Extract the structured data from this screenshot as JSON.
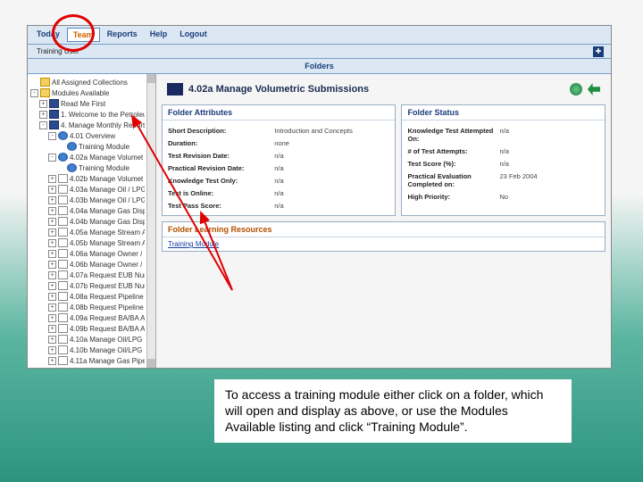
{
  "menu": {
    "items": [
      "Today",
      "Team",
      "Reports",
      "Help",
      "Logout"
    ],
    "active_index": 1
  },
  "subbar": {
    "label": "Training User"
  },
  "folders_bar": "Folders",
  "tree": [
    {
      "depth": 0,
      "type": "folder-y",
      "exp": "",
      "label": "All Assigned Collections"
    },
    {
      "depth": 0,
      "type": "folder-y",
      "exp": "-",
      "label": "Modules Available"
    },
    {
      "depth": 1,
      "type": "folder-b",
      "exp": "+",
      "label": "Read Me First"
    },
    {
      "depth": 1,
      "type": "folder-b",
      "exp": "+",
      "label": "1. Welcome to the Petroleu"
    },
    {
      "depth": 1,
      "type": "folder-b",
      "exp": "-",
      "label": "4. Manage Monthly Report"
    },
    {
      "depth": 2,
      "type": "globe",
      "exp": "-",
      "label": "4.01 Overview"
    },
    {
      "depth": 3,
      "type": "globe",
      "exp": "",
      "label": "Training Module"
    },
    {
      "depth": 2,
      "type": "globe",
      "exp": "-",
      "label": "4.02a Manage Volumet"
    },
    {
      "depth": 3,
      "type": "globe",
      "exp": "",
      "label": "Training Module"
    },
    {
      "depth": 2,
      "type": "doc",
      "exp": "+",
      "label": "4.02b Manage Volumet"
    },
    {
      "depth": 2,
      "type": "doc",
      "exp": "+",
      "label": "4.03a Manage Oil / LPG"
    },
    {
      "depth": 2,
      "type": "doc",
      "exp": "+",
      "label": "4.03b Manage Oil / LPG"
    },
    {
      "depth": 2,
      "type": "doc",
      "exp": "+",
      "label": "4.04a Manage Gas Disp"
    },
    {
      "depth": 2,
      "type": "doc",
      "exp": "+",
      "label": "4.04b Manage Gas Disp"
    },
    {
      "depth": 2,
      "type": "doc",
      "exp": "+",
      "label": "4.05a Manage Stream A"
    },
    {
      "depth": 2,
      "type": "doc",
      "exp": "+",
      "label": "4.05b Manage Stream A"
    },
    {
      "depth": 2,
      "type": "doc",
      "exp": "+",
      "label": "4.06a Manage Owner /"
    },
    {
      "depth": 2,
      "type": "doc",
      "exp": "+",
      "label": "4.06b Manage Owner /"
    },
    {
      "depth": 2,
      "type": "doc",
      "exp": "+",
      "label": "4.07a Request EUB Nun"
    },
    {
      "depth": 2,
      "type": "doc",
      "exp": "+",
      "label": "4.07b Request EUB Nun"
    },
    {
      "depth": 2,
      "type": "doc",
      "exp": "+",
      "label": "4.08a Request Pipeline"
    },
    {
      "depth": 2,
      "type": "doc",
      "exp": "+",
      "label": "4.08b Request Pipeline"
    },
    {
      "depth": 2,
      "type": "doc",
      "exp": "+",
      "label": "4.09a Request BA/BA A"
    },
    {
      "depth": 2,
      "type": "doc",
      "exp": "+",
      "label": "4.09b Request BA/BA A"
    },
    {
      "depth": 2,
      "type": "doc",
      "exp": "+",
      "label": "4.10a Manage Oil/LPG"
    },
    {
      "depth": 2,
      "type": "doc",
      "exp": "+",
      "label": "4.10b Manage Oil/LPG"
    },
    {
      "depth": 2,
      "type": "doc",
      "exp": "+",
      "label": "4.11a Manage Gas Pipe"
    }
  ],
  "pane": {
    "title": "4.02a Manage Volumetric Submissions",
    "attr_title": "Folder Attributes",
    "status_title": "Folder Status",
    "attrs": [
      {
        "k": "Short Description:",
        "v": "Introduction and Concepts"
      },
      {
        "k": "Duration:",
        "v": "none"
      },
      {
        "k": "Test Revision Date:",
        "v": "n/a"
      },
      {
        "k": "Practical Revision Date:",
        "v": "n/a"
      },
      {
        "k": "Knowledge Test Only:",
        "v": "n/a"
      },
      {
        "k": "Test is Online:",
        "v": "n/a"
      },
      {
        "k": "Test Pass Score:",
        "v": "n/a"
      }
    ],
    "status": [
      {
        "k": "Knowledge Test Attempted On:",
        "v": "n/a"
      },
      {
        "k": "# of Test Attempts:",
        "v": "n/a"
      },
      {
        "k": "Test Score (%):",
        "v": "n/a"
      },
      {
        "k": "Practical Evaluation Completed on:",
        "v": "23 Feb 2004"
      },
      {
        "k": "High Priority:",
        "v": "No"
      }
    ],
    "learning_title": "Folder Learning Resources",
    "learning_link": "Training Module"
  },
  "caption": "To access a training module either click on a folder, which will open and display as above, or use the Modules Available listing and click “Training Module”."
}
